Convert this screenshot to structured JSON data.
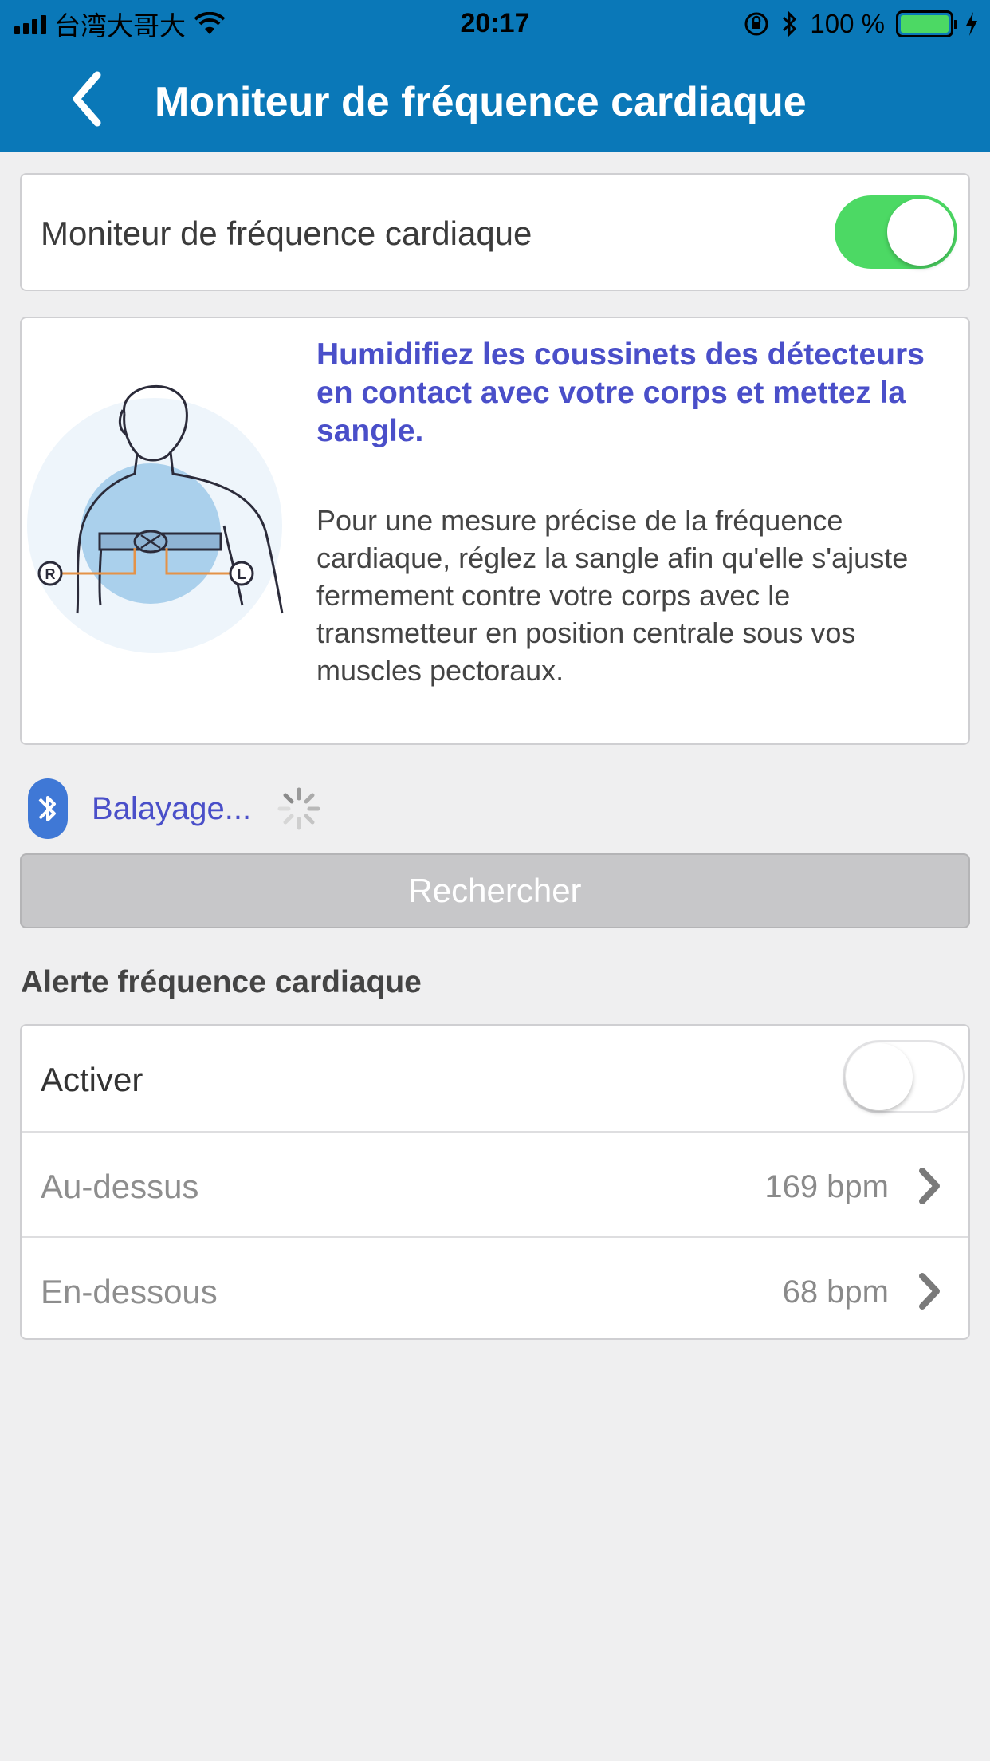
{
  "status_bar": {
    "carrier": "台湾大哥大",
    "time": "20:17",
    "battery": "100 %"
  },
  "nav": {
    "title": "Moniteur de fréquence cardiaque"
  },
  "hrm_toggle": {
    "label": "Moniteur de fréquence cardiaque",
    "on": true
  },
  "info": {
    "title": "Humidifiez les coussinets des détecteurs en contact avec votre corps et mettez la sangle.",
    "body": "Pour une mesure précise de la fréquence cardiaque, réglez la sangle afin qu'elle s'ajuste fermement contre votre corps avec le transmetteur en position centrale sous vos muscles pectoraux.",
    "figure_left": "R",
    "figure_right": "L"
  },
  "scan": {
    "status": "Balayage..."
  },
  "search_button": "Rechercher",
  "alert": {
    "section_title": "Alerte fréquence cardiaque",
    "enable_label": "Activer",
    "enabled": false,
    "above_label": "Au-dessus",
    "above_value": "169 bpm",
    "below_label": "En-dessous",
    "below_value": "68 bpm"
  },
  "colors": {
    "nav_bg": "#0a78b8",
    "toggle_on": "#4cd964",
    "accent_text": "#4a4fc9",
    "bluetooth": "#3f78d6"
  }
}
